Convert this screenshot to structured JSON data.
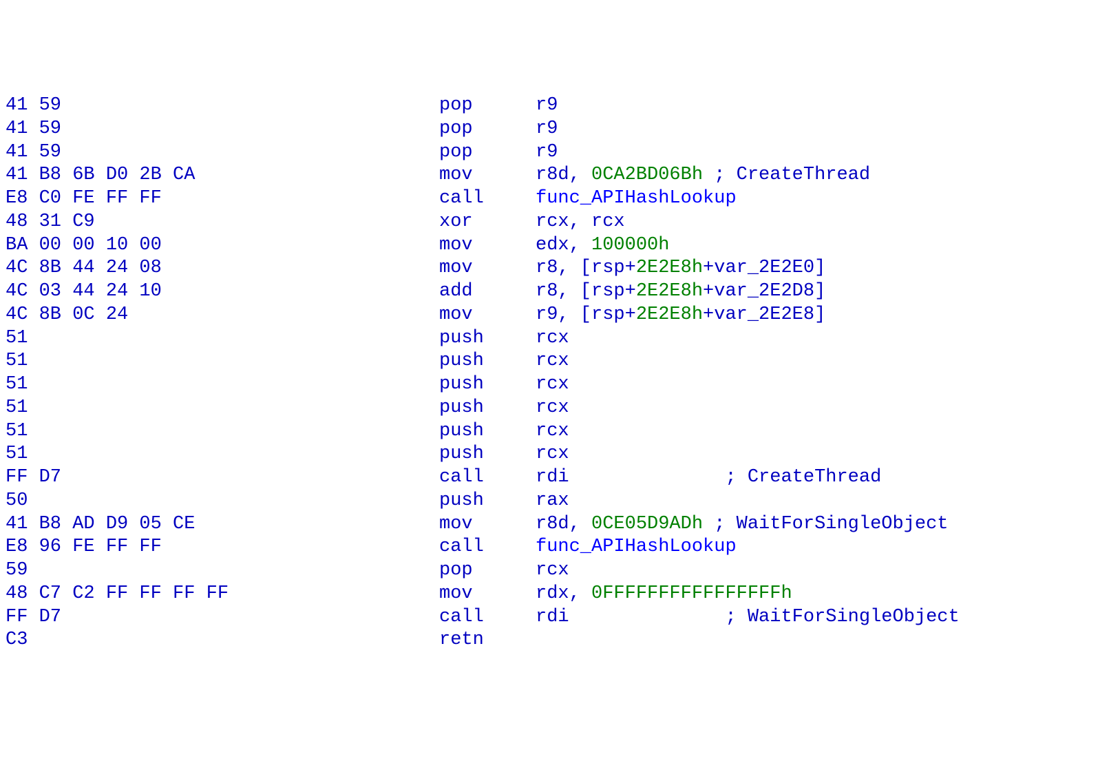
{
  "disassembly": {
    "lines": [
      {
        "hex": "41 59",
        "mnemonic": "pop",
        "operands": [
          {
            "t": "reg",
            "v": "r9"
          }
        ]
      },
      {
        "hex": "41 59",
        "mnemonic": "pop",
        "operands": [
          {
            "t": "reg",
            "v": "r9"
          }
        ]
      },
      {
        "hex": "41 59",
        "mnemonic": "pop",
        "operands": [
          {
            "t": "reg",
            "v": "r9"
          }
        ]
      },
      {
        "hex": "41 B8 6B D0 2B CA",
        "mnemonic": "mov",
        "operands": [
          {
            "t": "reg",
            "v": "r8d"
          },
          {
            "t": "txt",
            "v": ", "
          },
          {
            "t": "num",
            "v": "0CA2BD06Bh"
          },
          {
            "t": "txt",
            "v": " ; "
          },
          {
            "t": "reg",
            "v": "CreateThread"
          }
        ]
      },
      {
        "hex": "E8 C0 FE FF FF",
        "mnemonic": "call",
        "operands": [
          {
            "t": "func",
            "v": "func_APIHashLookup"
          }
        ]
      },
      {
        "hex": "48 31 C9",
        "mnemonic": "xor",
        "operands": [
          {
            "t": "reg",
            "v": "rcx"
          },
          {
            "t": "txt",
            "v": ", "
          },
          {
            "t": "reg",
            "v": "rcx"
          }
        ]
      },
      {
        "hex": "BA 00 00 10 00",
        "mnemonic": "mov",
        "operands": [
          {
            "t": "reg",
            "v": "edx"
          },
          {
            "t": "txt",
            "v": ", "
          },
          {
            "t": "num",
            "v": "100000h"
          }
        ]
      },
      {
        "hex": "4C 8B 44 24 08",
        "mnemonic": "mov",
        "operands": [
          {
            "t": "reg",
            "v": "r8"
          },
          {
            "t": "txt",
            "v": ", ["
          },
          {
            "t": "reg",
            "v": "rsp"
          },
          {
            "t": "txt",
            "v": "+"
          },
          {
            "t": "num",
            "v": "2E2E8h"
          },
          {
            "t": "txt",
            "v": "+"
          },
          {
            "t": "var",
            "v": "var_2E2E0"
          },
          {
            "t": "txt",
            "v": "]"
          }
        ]
      },
      {
        "hex": "4C 03 44 24 10",
        "mnemonic": "add",
        "operands": [
          {
            "t": "reg",
            "v": "r8"
          },
          {
            "t": "txt",
            "v": ", ["
          },
          {
            "t": "reg",
            "v": "rsp"
          },
          {
            "t": "txt",
            "v": "+"
          },
          {
            "t": "num",
            "v": "2E2E8h"
          },
          {
            "t": "txt",
            "v": "+"
          },
          {
            "t": "var",
            "v": "var_2E2D8"
          },
          {
            "t": "txt",
            "v": "]"
          }
        ]
      },
      {
        "hex": "4C 8B 0C 24",
        "mnemonic": "mov",
        "operands": [
          {
            "t": "reg",
            "v": "r9"
          },
          {
            "t": "txt",
            "v": ", ["
          },
          {
            "t": "reg",
            "v": "rsp"
          },
          {
            "t": "txt",
            "v": "+"
          },
          {
            "t": "num",
            "v": "2E2E8h"
          },
          {
            "t": "txt",
            "v": "+"
          },
          {
            "t": "var",
            "v": "var_2E2E8"
          },
          {
            "t": "txt",
            "v": "]"
          }
        ]
      },
      {
        "hex": "51",
        "mnemonic": "push",
        "operands": [
          {
            "t": "reg",
            "v": "rcx"
          }
        ]
      },
      {
        "hex": "51",
        "mnemonic": "push",
        "operands": [
          {
            "t": "reg",
            "v": "rcx"
          }
        ]
      },
      {
        "hex": "51",
        "mnemonic": "push",
        "operands": [
          {
            "t": "reg",
            "v": "rcx"
          }
        ]
      },
      {
        "hex": "51",
        "mnemonic": "push",
        "operands": [
          {
            "t": "reg",
            "v": "rcx"
          }
        ]
      },
      {
        "hex": "51",
        "mnemonic": "push",
        "operands": [
          {
            "t": "reg",
            "v": "rcx"
          }
        ]
      },
      {
        "hex": "51",
        "mnemonic": "push",
        "operands": [
          {
            "t": "reg",
            "v": "rcx"
          }
        ]
      },
      {
        "hex": "FF D7",
        "mnemonic": "call",
        "operands": [
          {
            "t": "reg",
            "v": "rdi"
          },
          {
            "t": "pad",
            "v": "              "
          },
          {
            "t": "txt",
            "v": "; "
          },
          {
            "t": "reg",
            "v": "CreateThread"
          }
        ]
      },
      {
        "hex": "50",
        "mnemonic": "push",
        "operands": [
          {
            "t": "reg",
            "v": "rax"
          }
        ]
      },
      {
        "hex": "41 B8 AD D9 05 CE",
        "mnemonic": "mov",
        "operands": [
          {
            "t": "reg",
            "v": "r8d"
          },
          {
            "t": "txt",
            "v": ", "
          },
          {
            "t": "num",
            "v": "0CE05D9ADh"
          },
          {
            "t": "txt",
            "v": " ; "
          },
          {
            "t": "reg",
            "v": "WaitForSingleObject"
          }
        ]
      },
      {
        "hex": "E8 96 FE FF FF",
        "mnemonic": "call",
        "operands": [
          {
            "t": "func",
            "v": "func_APIHashLookup"
          }
        ]
      },
      {
        "hex": "59",
        "mnemonic": "pop",
        "operands": [
          {
            "t": "reg",
            "v": "rcx"
          }
        ]
      },
      {
        "hex": "48 C7 C2 FF FF FF FF",
        "mnemonic": "mov",
        "operands": [
          {
            "t": "reg",
            "v": "rdx"
          },
          {
            "t": "txt",
            "v": ", "
          },
          {
            "t": "num",
            "v": "0FFFFFFFFFFFFFFFFh"
          }
        ]
      },
      {
        "hex": "FF D7",
        "mnemonic": "call",
        "operands": [
          {
            "t": "reg",
            "v": "rdi"
          },
          {
            "t": "pad",
            "v": "              "
          },
          {
            "t": "txt",
            "v": "; "
          },
          {
            "t": "reg",
            "v": "WaitForSingleObject"
          }
        ]
      },
      {
        "hex": "C3",
        "mnemonic": "retn",
        "operands": []
      }
    ]
  }
}
